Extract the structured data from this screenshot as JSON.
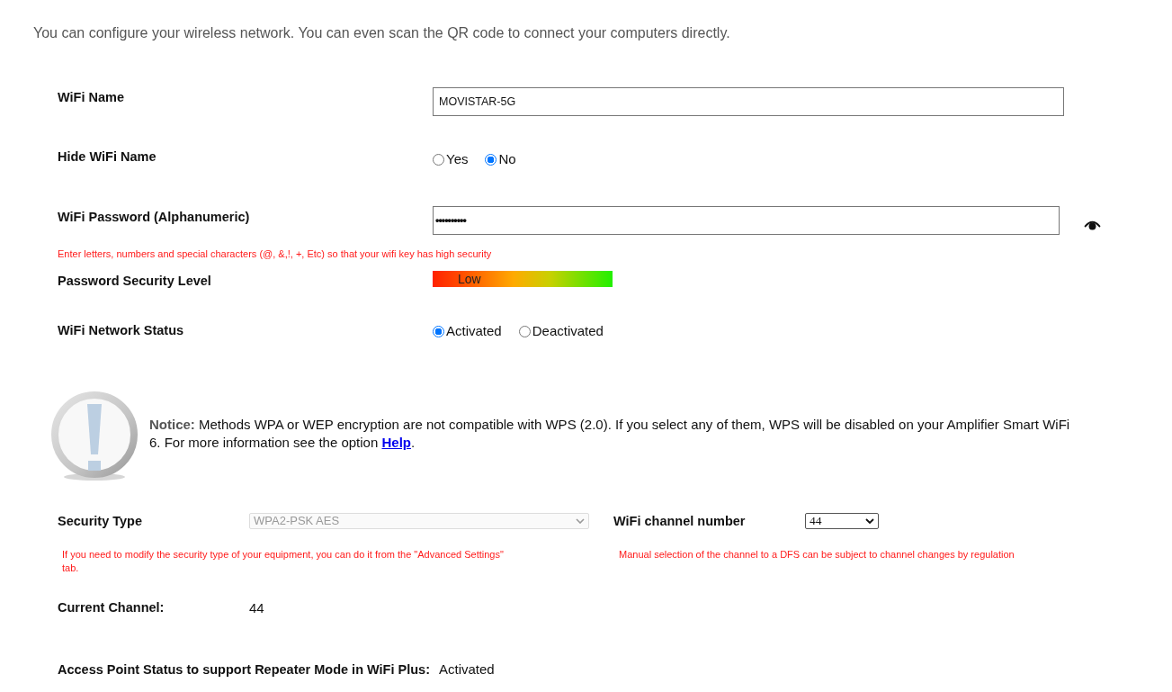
{
  "intro": "You can configure your wireless network. You can even scan the QR code to connect your computers directly.",
  "wifi_name": {
    "label": "WiFi Name",
    "value": "MOVISTAR-5G"
  },
  "hide_wifi_name": {
    "label": "Hide WiFi Name",
    "options": [
      {
        "label": "Yes",
        "selected": false
      },
      {
        "label": "No",
        "selected": true
      }
    ]
  },
  "wifi_password": {
    "label": "WiFi Password (Alphanumeric)",
    "value": "••••••••••",
    "hint": "Enter letters, numbers and special characters (@, &,!, +, Etc) so that your wifi key has high security"
  },
  "password_security": {
    "label": "Password Security Level",
    "reading": "Low"
  },
  "network_status": {
    "label": "WiFi Network Status",
    "options": [
      {
        "label": "Activated",
        "selected": true
      },
      {
        "label": "Deactivated",
        "selected": false
      }
    ]
  },
  "notice": {
    "text": "**Notice:** Methods WPA or WEP encryption are not compatible with WPS (2.0). If you select any of them, WPS will be disabled on your Amplifier Smart WiFi 6. For more information see the option ",
    "link": "Help",
    "end": "."
  },
  "security_type": {
    "label": "Security Type",
    "value": "WPA2-PSK AES",
    "disabled": true,
    "hint": "If you need to modify the security type of your equipment, you can do it from the \"Advanced Settings\" tab."
  },
  "channel_number": {
    "label": "WiFi channel number",
    "value": "44",
    "disabled": false,
    "hint": "Manual selection of the channel to a DFS can be subject to channel changes by regulation"
  },
  "current_channel": {
    "label": "Current Channel:",
    "value": "44"
  },
  "access_point": {
    "label": "Access Point Status to support Repeater Mode in WiFi Plus:",
    "value": "Activated"
  }
}
